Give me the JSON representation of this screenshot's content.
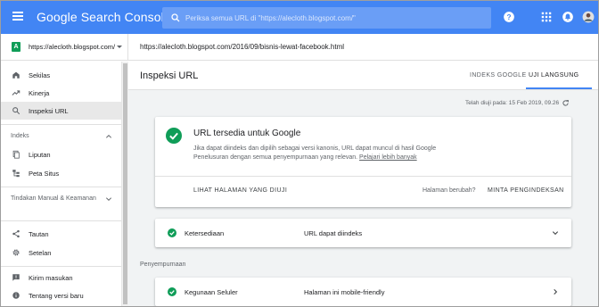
{
  "header": {
    "brand": "Google Search Console",
    "search": {
      "placeholder": "Periksa semua URL di \"https://alecloth.blogspot.com/\""
    },
    "accent": "#4285f4"
  },
  "property": {
    "badge": "A",
    "name": "https://alecloth.blogspot.com/",
    "inspected_url": "https://alecloth.blogspot.com/2016/09/bisnis-lewat-facebook.html"
  },
  "sidebar": {
    "items": [
      {
        "label": "Sekilas",
        "icon": "home-icon"
      },
      {
        "label": "Kinerja",
        "icon": "trending-up-icon"
      },
      {
        "label": "Inspeksi URL",
        "icon": "search-icon",
        "active": true
      },
      {
        "label": "Liputan",
        "icon": "coverage-icon"
      },
      {
        "label": "Peta Situs",
        "icon": "sitemap-icon"
      },
      {
        "label": "Tautan",
        "icon": "links-icon"
      },
      {
        "label": "Setelan",
        "icon": "gear-icon"
      },
      {
        "label": "Kirim masukan",
        "icon": "feedback-icon"
      },
      {
        "label": "Tentang versi baru",
        "icon": "info-icon"
      }
    ],
    "sections": {
      "index": "Indeks",
      "manual": "Tindakan Manual & Keamanan"
    }
  },
  "main": {
    "title": "Inspeksi URL",
    "tabs": [
      {
        "label": "INDEKS GOOGLE"
      },
      {
        "label": "UJI LANGSUNG",
        "active": true
      }
    ],
    "tested_at": "Telah diuji pada: 15 Feb 2019, 09.26",
    "result_card": {
      "title": "URL tersedia untuk Google",
      "description": "Jika dapat diindeks dan dipilih sebagai versi kanonis, URL dapat muncul di hasil Google Penelusuran dengan semua penyempurnaan yang relevan.",
      "link": "Pelajari lebih banyak",
      "view_button": "LIHAT HALAMAN YANG DIUJI",
      "changed_question": "Halaman berubah?",
      "request_button": "MINTA PENGINDEKSAN"
    },
    "availability": {
      "label": "Ketersediaan",
      "value": "URL dapat diindeks"
    },
    "enhancements_label": "Penyempurnaan",
    "mobile": {
      "label": "Kegunaan Seluler",
      "value": "Halaman ini mobile-friendly"
    },
    "status_color": "#0f9d58"
  }
}
